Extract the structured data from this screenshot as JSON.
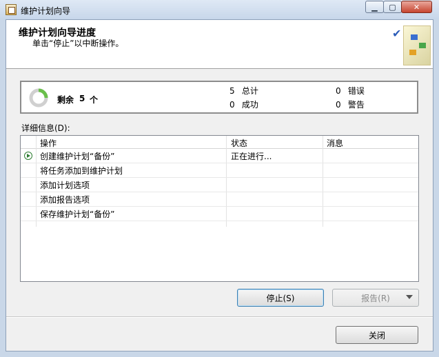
{
  "window": {
    "title": "维护计划向导"
  },
  "header": {
    "title": "维护计划向导进度",
    "subtitle": "单击“停止”以中断操作。"
  },
  "progress": {
    "remaining_label": "剩余",
    "remaining_count": "5",
    "remaining_unit": "个",
    "total_value": "5",
    "total_label": "总计",
    "success_value": "0",
    "success_label": "成功",
    "error_value": "0",
    "error_label": "错误",
    "warning_value": "0",
    "warning_label": "警告"
  },
  "details": {
    "label": "详细信息(D):",
    "columns": {
      "action": "操作",
      "status": "状态",
      "message": "消息"
    },
    "rows": [
      {
        "action": "创建维护计划“备份”",
        "status": "正在进行...",
        "message": "",
        "icon": "play-icon"
      },
      {
        "action": "将任务添加到维护计划",
        "status": "",
        "message": ""
      },
      {
        "action": "添加计划选项",
        "status": "",
        "message": ""
      },
      {
        "action": "添加报告选项",
        "status": "",
        "message": ""
      },
      {
        "action": "保存维护计划“备份”",
        "status": "",
        "message": ""
      }
    ]
  },
  "buttons": {
    "stop": "停止(S)",
    "report": "报告(R)",
    "close": "关闭"
  }
}
